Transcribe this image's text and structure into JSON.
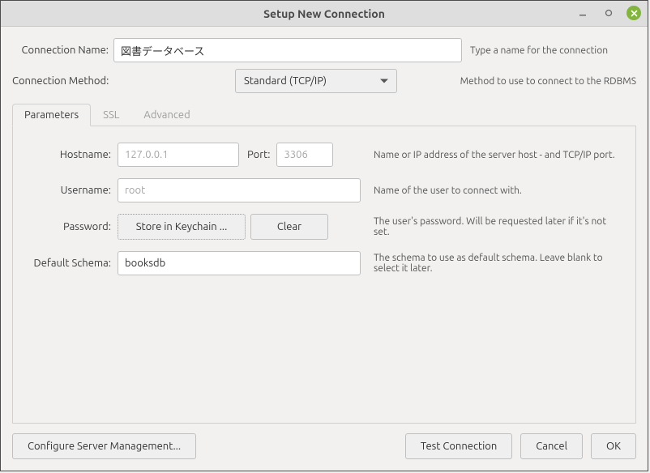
{
  "window": {
    "title": "Setup New Connection"
  },
  "connection": {
    "name_label": "Connection Name:",
    "name_value": "図書データベース",
    "name_hint": "Type a name for the connection",
    "method_label": "Connection Method:",
    "method_value": "Standard (TCP/IP)",
    "method_hint": "Method to use to connect to the RDBMS"
  },
  "tabs": {
    "parameters": "Parameters",
    "ssl": "SSL",
    "advanced": "Advanced"
  },
  "params": {
    "hostname_label": "Hostname:",
    "hostname_placeholder": "127.0.0.1",
    "port_label": "Port:",
    "port_placeholder": "3306",
    "host_hint": "Name or IP address of the server host - and TCP/IP port.",
    "username_label": "Username:",
    "username_placeholder": "root",
    "username_hint": "Name of the user to connect with.",
    "password_label": "Password:",
    "store_btn": "Store in Keychain ...",
    "clear_btn": "Clear",
    "password_hint": "The user's password. Will be requested later if it's not set.",
    "schema_label": "Default Schema:",
    "schema_value": "booksdb",
    "schema_hint": "The schema to use as default schema. Leave blank to select it later."
  },
  "footer": {
    "configure_btn": "Configure Server Management...",
    "test_btn": "Test Connection",
    "cancel_btn": "Cancel",
    "ok_btn": "OK"
  }
}
